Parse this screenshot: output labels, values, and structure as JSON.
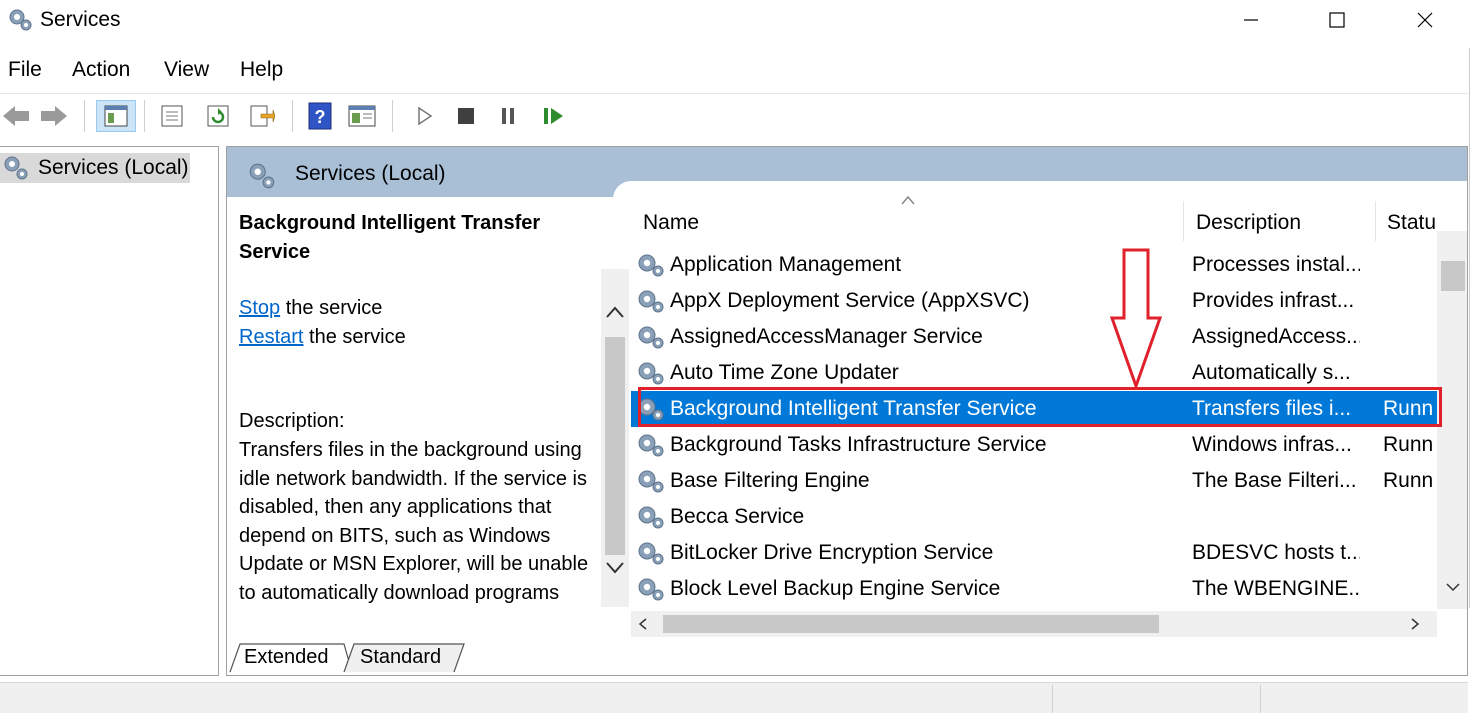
{
  "window": {
    "title": "Services",
    "controls": [
      "minimize",
      "maximize",
      "close"
    ]
  },
  "menu": [
    "File",
    "Action",
    "View",
    "Help"
  ],
  "toolbar": {
    "buttons": [
      "back-icon",
      "forward-icon",
      "show-hide-console-tree-icon",
      "properties-icon",
      "refresh-icon",
      "export-list-icon",
      "help-icon",
      "show-action-pane-icon",
      "start-service-icon",
      "stop-service-icon",
      "pause-service-icon",
      "restart-service-icon"
    ]
  },
  "tree": {
    "root_label": "Services (Local)"
  },
  "main": {
    "header_title": "Services (Local)",
    "selected_service_title": "Background Intelligent Transfer Service",
    "actions": [
      {
        "link": "Stop",
        "rest": " the service"
      },
      {
        "link": "Restart",
        "rest": " the service"
      }
    ],
    "description_label": "Description:",
    "description_text": "Transfers files in the background using idle network bandwidth. If the service is disabled, then any applications that depend on BITS, such as Windows Update or MSN Explorer, will be unable to automatically download programs"
  },
  "list": {
    "columns": [
      "Name",
      "Description",
      "Statu"
    ],
    "rows": [
      {
        "name": "Application Management",
        "description": "Processes instal...",
        "status": ""
      },
      {
        "name": "AppX Deployment Service (AppXSVC)",
        "description": "Provides infrast...",
        "status": ""
      },
      {
        "name": "AssignedAccessManager Service",
        "description": "AssignedAccess...",
        "status": ""
      },
      {
        "name": "Auto Time Zone Updater",
        "description": "Automatically s...",
        "status": ""
      },
      {
        "name": "Background Intelligent Transfer Service",
        "description": "Transfers files i...",
        "status": "Runn",
        "selected": true
      },
      {
        "name": "Background Tasks Infrastructure Service",
        "description": "Windows infras...",
        "status": "Runn"
      },
      {
        "name": "Base Filtering Engine",
        "description": "The Base Filteri...",
        "status": "Runn"
      },
      {
        "name": "Becca Service",
        "description": "",
        "status": ""
      },
      {
        "name": "BitLocker Drive Encryption Service",
        "description": "BDESVC hosts t...",
        "status": ""
      },
      {
        "name": "Block Level Backup Engine Service",
        "description": "The WBENGINE...",
        "status": ""
      }
    ]
  },
  "tabs": [
    "Extended",
    "Standard"
  ],
  "colors": {
    "selection": "#0078d7",
    "header_band": "#a9bfd6",
    "annotation_red": "#e0202a",
    "link": "#0066cc"
  }
}
